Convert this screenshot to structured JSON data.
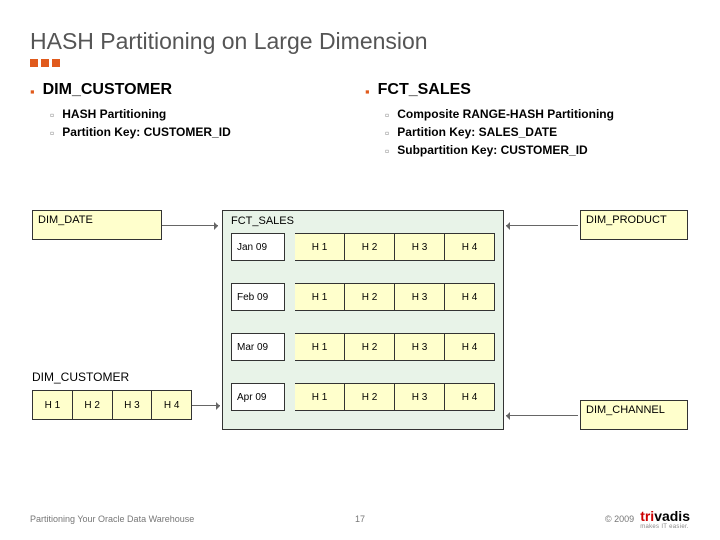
{
  "title": "HASH Partitioning on Large Dimension",
  "left": {
    "heading": "DIM_CUSTOMER",
    "subs": [
      "HASH Partitioning",
      "Partition Key: CUSTOMER_ID"
    ]
  },
  "right": {
    "heading": "FCT_SALES",
    "subs": [
      "Composite RANGE-HASH Partitioning",
      "Partition Key: SALES_DATE",
      "Subpartition Key: CUSTOMER_ID"
    ]
  },
  "dim_date": "DIM_DATE",
  "dim_product": "DIM_PRODUCT",
  "dim_channel": "DIM_CHANNEL",
  "dim_customer_label": "DIM_CUSTOMER",
  "hash_cells": [
    "H 1",
    "H 2",
    "H 3",
    "H 4"
  ],
  "fct_title": "FCT_SALES",
  "fct_rows": [
    {
      "month": "Jan 09",
      "h": [
        "H 1",
        "H 2",
        "H 3",
        "H 4"
      ]
    },
    {
      "month": "Feb 09",
      "h": [
        "H 1",
        "H 2",
        "H 3",
        "H 4"
      ]
    },
    {
      "month": "Mar 09",
      "h": [
        "H 1",
        "H 2",
        "H 3",
        "H 4"
      ]
    },
    {
      "month": "Apr 09",
      "h": [
        "H 1",
        "H 2",
        "H 3",
        "H 4"
      ]
    }
  ],
  "footer_left": "Partitioning Your Oracle Data Warehouse",
  "page_num": "17",
  "copyright": "© 2009",
  "logo_tri": "tri",
  "logo_vadis": "vadis",
  "logo_tag": "makes IT easier."
}
